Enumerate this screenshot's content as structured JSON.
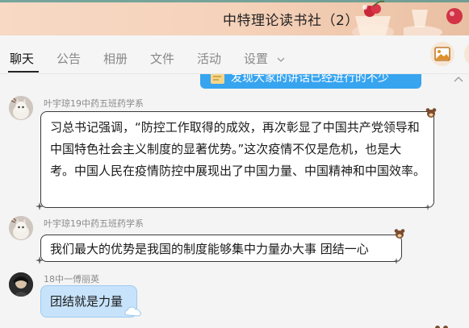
{
  "window": {
    "title": "中特理论读书社（2）",
    "colors": {
      "titlebar": "#f5d2ba",
      "accent_blue": "#37a4f0",
      "tab_active": "#111111",
      "tab_inactive": "#888888"
    }
  },
  "tabs": [
    {
      "label": "聊天",
      "active": true
    },
    {
      "label": "公告"
    },
    {
      "label": "相册"
    },
    {
      "label": "文件"
    },
    {
      "label": "活动"
    },
    {
      "label": "设置",
      "has_dropdown": true
    }
  ],
  "toolbar": {
    "icons": [
      "image-icon",
      "more-icon"
    ]
  },
  "chat": {
    "partial_top_message": {
      "text": "发现大家的讲话已经进行的不少",
      "icon": "note-icon"
    },
    "messages": [
      {
        "sender": "叶宇琼19中药五班药学系",
        "text": "习总书记强调，“防控工作取得的成效，再次彰显了中国共产党领导和中国特色社会主义制度的显著优势。”这次疫情不仅是危机，也是大考。中国人民在疫情防控中展现出了中国力量、中国精神和中国效率。",
        "style": "white-bordered"
      },
      {
        "sender": "叶宇琼19中药五班药学系",
        "text": "我们最大的优势是我国的制度能够集中力量办大事 团结一心",
        "style": "white-bordered"
      },
      {
        "sender": "18中一傅丽英",
        "text": "团结就是力量",
        "style": "light-blue"
      }
    ]
  }
}
